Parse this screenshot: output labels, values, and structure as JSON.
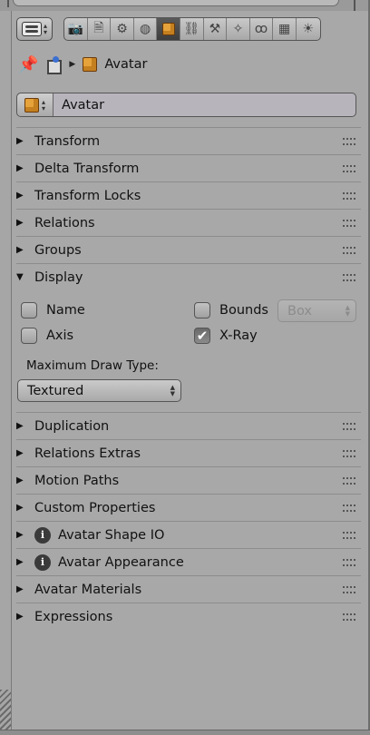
{
  "header": {
    "tabs": [
      {
        "name": "tab-render",
        "icon": "camera-icon",
        "glyph": "📷"
      },
      {
        "name": "tab-render-layers",
        "icon": "layers-icon",
        "glyph": "🗎"
      },
      {
        "name": "tab-scene",
        "icon": "scene-icon",
        "glyph": "⚙"
      },
      {
        "name": "tab-world",
        "icon": "world-icon",
        "glyph": "◍"
      },
      {
        "name": "tab-object",
        "icon": "object-cube-icon",
        "glyph": ""
      },
      {
        "name": "tab-constraints",
        "icon": "chain-link-icon",
        "glyph": "⛓"
      },
      {
        "name": "tab-modifiers",
        "icon": "modifier-figure-icon",
        "glyph": "⚒"
      },
      {
        "name": "tab-bones",
        "icon": "bone-icon",
        "glyph": "✧"
      },
      {
        "name": "tab-physics",
        "icon": "physics-icon",
        "glyph": "ꝏ"
      },
      {
        "name": "tab-texture",
        "icon": "checker-icon",
        "glyph": "▦"
      },
      {
        "name": "tab-particles",
        "icon": "lamp-icon",
        "glyph": "☀"
      }
    ]
  },
  "breadcrumb": {
    "label": "Avatar"
  },
  "object": {
    "name": "Avatar"
  },
  "sections": [
    {
      "label": "Transform",
      "expanded": false
    },
    {
      "label": "Delta Transform",
      "expanded": false
    },
    {
      "label": "Transform Locks",
      "expanded": false
    },
    {
      "label": "Relations",
      "expanded": false
    },
    {
      "label": "Groups",
      "expanded": false
    },
    {
      "label": "Display",
      "expanded": true
    },
    {
      "label": "Duplication",
      "expanded": false
    },
    {
      "label": "Relations Extras",
      "expanded": false
    },
    {
      "label": "Motion Paths",
      "expanded": false
    },
    {
      "label": "Custom Properties",
      "expanded": false
    },
    {
      "label": "Avatar Shape IO",
      "expanded": false
    },
    {
      "label": "Avatar Appearance",
      "expanded": false
    },
    {
      "label": "Avatar Materials",
      "expanded": false
    },
    {
      "label": "Expressions",
      "expanded": false
    }
  ],
  "display": {
    "name_label": "Name",
    "name_checked": false,
    "axis_label": "Axis",
    "axis_checked": false,
    "bounds_label": "Bounds",
    "bounds_checked": false,
    "bounds_type": "Box",
    "xray_label": "X-Ray",
    "xray_checked": true,
    "max_draw_type_label": "Maximum Draw Type:",
    "max_draw_type": "Textured"
  },
  "glyphs": {
    "collapsed": "▶",
    "expanded": "▼",
    "check": "✔",
    "info": "i",
    "pin": "📌"
  }
}
